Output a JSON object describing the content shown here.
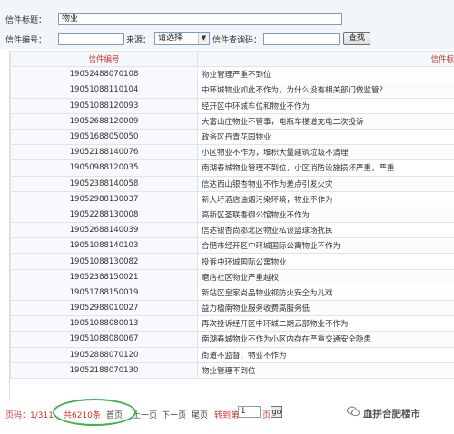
{
  "search": {
    "title_label": "信件标题：",
    "title_value": "物业",
    "number_label": "信件编号：",
    "number_value": "",
    "source_label": "来源：",
    "source_selected": "请选择",
    "query_code_label": "信件查询码：",
    "query_code_value": "",
    "search_button": "查找"
  },
  "table": {
    "headers": [
      "信件编号",
      "信件标"
    ],
    "rows": [
      {
        "num": "19052488070108",
        "title": "物业管理严重不到位"
      },
      {
        "num": "19051088110104",
        "title": "中环城物业如此不作为，为什么没有相关部门做监管？"
      },
      {
        "num": "19051088120093",
        "title": "经开区中环城车位和物业不作为"
      },
      {
        "num": "19052688120009",
        "title": "大富山庄物业不管事，电瓶车楼道充电二次投诉"
      },
      {
        "num": "19051688050050",
        "title": "政务区丹青花园物业"
      },
      {
        "num": "19052188140076",
        "title": "小区物业不作为，堆积大量建筑垃圾不清理"
      },
      {
        "num": "19050988120035",
        "title": "南湖春城物业管理不到位，小区消防设施损坏严重，严重"
      },
      {
        "num": "19052388140058",
        "title": "信达西山银杏物业不作为差点引发火灾"
      },
      {
        "num": "19052988130037",
        "title": "新大圩酒店油烟污染环境，物业不作为"
      },
      {
        "num": "19052288130008",
        "title": "高新区圣联香御公馆物业不作为"
      },
      {
        "num": "19052688140039",
        "title": "信达银杏尚郡北区物业私设篮球场扰民"
      },
      {
        "num": "19051088140103",
        "title": "合肥市经开区中环城国际公寓物业不作为"
      },
      {
        "num": "19051088130082",
        "title": "投诉中环城国际公寓物业"
      },
      {
        "num": "19052388150021",
        "title": "磨店社区物业严重越权"
      },
      {
        "num": "19051788150019",
        "title": "新站区皇家尚品物业视防火安全为儿戏"
      },
      {
        "num": "19052988010027",
        "title": "益力楹南物业服务收费高服务低"
      },
      {
        "num": "19051088080013",
        "title": "再次投诉经开区中环城二期云部物业不作为"
      },
      {
        "num": "19051088080067",
        "title": "南湖春城物业不作为小区内存在严重交通安全隐患"
      },
      {
        "num": "19052888070120",
        "title": "街道不监督，物业不作为"
      },
      {
        "num": "19052188070130",
        "title": "物业管理不到位"
      }
    ]
  },
  "pager": {
    "page_info": "页码：1/311",
    "total": "共6210条",
    "first": "首页",
    "prev": "上一页",
    "next": "下一页",
    "last": "尾页",
    "goto_label": "转到第",
    "goto_value": "1",
    "page_unit": "页",
    "go": "go"
  },
  "watermark": "血拼合肥楼市",
  "colors": {
    "accent_red": "#d0342c",
    "highlight_green": "#3db34a"
  }
}
